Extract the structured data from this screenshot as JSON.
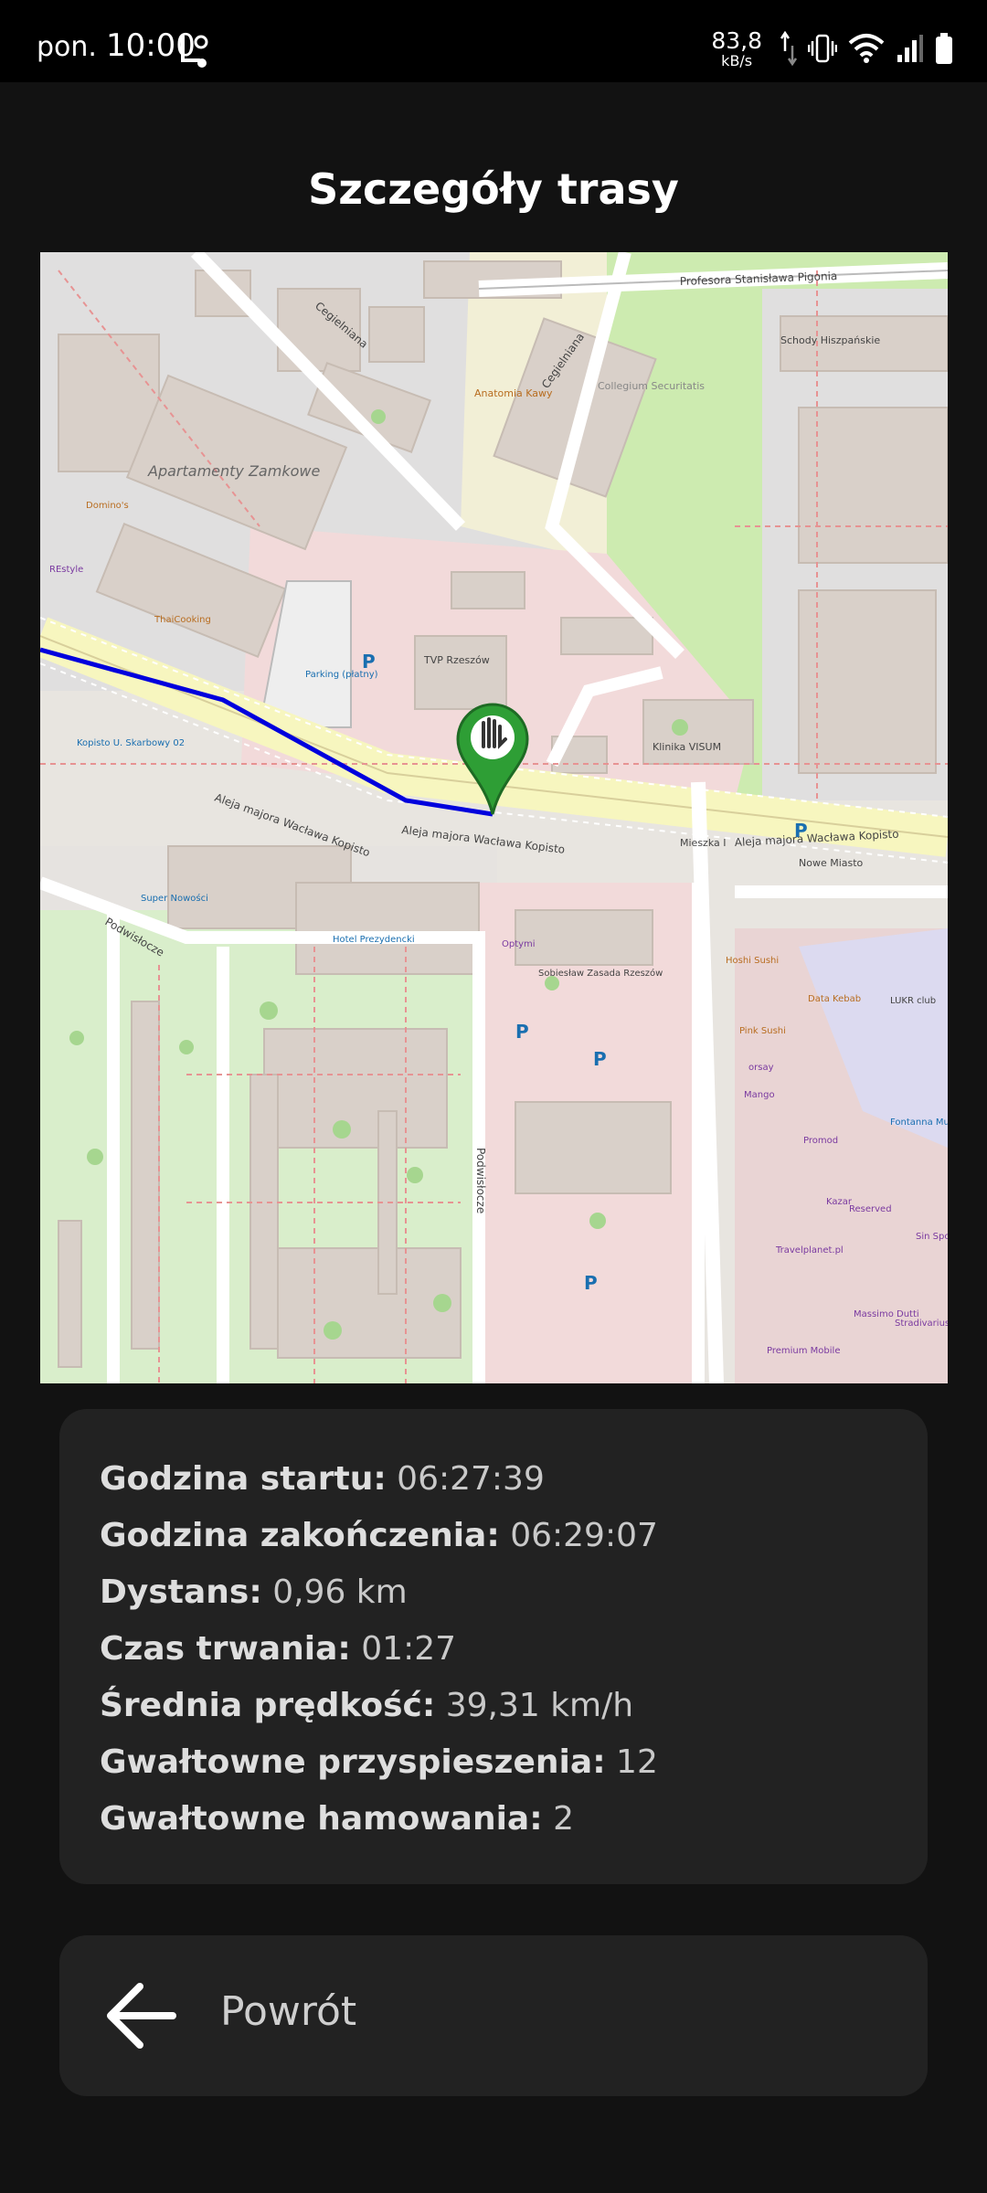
{
  "status_bar": {
    "day": "pon.",
    "time": "10:00",
    "network_speed_value": "83,8",
    "network_speed_unit": "kB/s",
    "icons": [
      "location-icon",
      "data-arrows-icon",
      "vibrate-icon",
      "wifi-icon",
      "signal-icon",
      "battery-icon"
    ]
  },
  "page": {
    "title": "Szczegóły trasy"
  },
  "map": {
    "labels": {
      "street_main": "Aleja majora Wacława Kopisto",
      "street_pigonia": "Profesora Stanisława Pigonia",
      "street_cegielniana": "Cegielniana",
      "street_podwislocze": "Podwisłocze",
      "street_mieszka": "Mieszka I",
      "street_nowe_miasto": "Nowe Miasto",
      "apartamenty": "Apartamenty Zamkowe",
      "parking": "Parking (płatny)",
      "tvp": "TVP Rzeszów",
      "klinika": "Klinika VISUM",
      "collegium": "Collegium Securitatis",
      "schody": "Schody Hiszpańskie",
      "anatomia": "Anatomia Kawy",
      "dominos": "Domino's",
      "restyle": "REstyle",
      "thai": "ThaiCooking",
      "kopisto_stop": "Kopisto U. Skarbowy 02",
      "super_nowosci": "Super Nowości",
      "hotel": "Hotel Prezydencki",
      "optymi": "Optymi",
      "sobieslaw": "Sobiesław Zasada Rzeszów",
      "hoshi": "Hoshi Sushi",
      "data_kebab": "Data Kebab",
      "lukr": "LUKR club",
      "pink_sushi": "Pink Sushi",
      "fontanna": "Fontanna Multimedialna",
      "promod": "Promod",
      "kazar": "Kazar",
      "reserved": "Reserved",
      "travelplanet": "Travelplanet.pl",
      "massimo": "Massimo Dutti",
      "stradivarius": "Stradivarius",
      "premium": "Premium Mobile",
      "mango": "Mango",
      "orsay": "orsay",
      "sinsay": "Sin Spot Mi"
    },
    "route_color": "#0000dd",
    "marker_color": "#2e9e35"
  },
  "details": {
    "start_label": "Godzina startu:",
    "start_value": "06:27:39",
    "end_label": "Godzina zakończenia:",
    "end_value": "06:29:07",
    "distance_label": "Dystans:",
    "distance_value": "0,96 km",
    "duration_label": "Czas trwania:",
    "duration_value": "01:27",
    "avg_speed_label": "Średnia prędkość:",
    "avg_speed_value": "39,31 km/h",
    "accel_label": "Gwałtowne przyspieszenia:",
    "accel_value": "12",
    "braking_label": "Gwałtowne hamowania:",
    "braking_value": "2"
  },
  "back_button": {
    "label": "Powrót",
    "icon": "arrow-left-icon"
  }
}
